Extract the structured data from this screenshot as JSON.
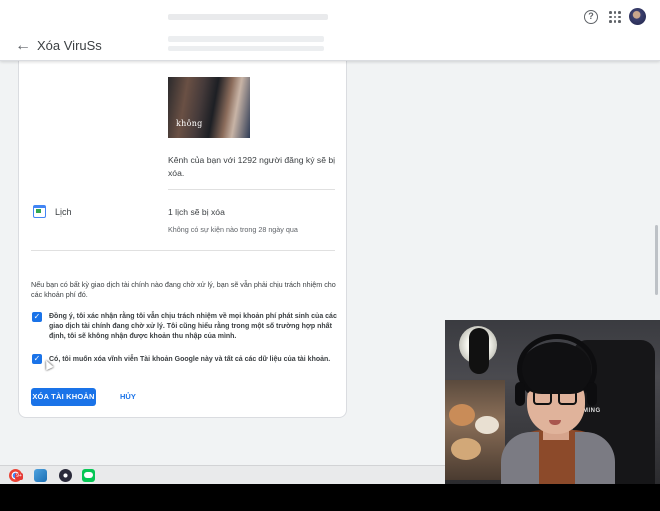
{
  "header": {
    "title": "Xóa ViruSs",
    "back_icon": "arrow-back-icon",
    "help_icon": "help-icon",
    "apps_icon": "apps-grid-icon"
  },
  "youtube": {
    "thumbnail_text": "không",
    "description": "Kênh của bạn với 1292 người đăng ký sẽ bị xóa."
  },
  "calendar": {
    "label": "Lịch",
    "count": "1 lịch sẽ bị xóa",
    "note": "Không có sự kiện nào trong 28 ngày qua"
  },
  "warning": "Nếu bạn có bất kỳ giao dịch tài chính nào đang chờ xử lý, bạn sẽ vẫn phải chịu trách nhiệm cho các khoản phí đó.",
  "agreements": [
    {
      "checked": true,
      "text": "Đồng ý, tôi xác nhận rằng tôi vẫn chịu trách nhiệm về mọi khoản phí phát sinh của các giao dịch tài chính đang chờ xử lý. Tôi cũng hiểu rằng trong một số trường hợp nhất định, tôi sẽ không nhận được khoản thu nhập của mình."
    },
    {
      "checked": true,
      "text": "Có, tôi muốn xóa vĩnh viễn Tài khoản Google này và tất cả các dữ liệu của tài khoản."
    }
  ],
  "actions": {
    "delete_label": "XÓA TÀI KHOẢN",
    "cancel_label": "HỦY"
  },
  "webcam": {
    "chair_logo": "MING"
  },
  "taskbar": {
    "chrome_badge": "9+"
  },
  "colors": {
    "primary": "#1a73e8",
    "page_bg": "#f1f3f4"
  }
}
